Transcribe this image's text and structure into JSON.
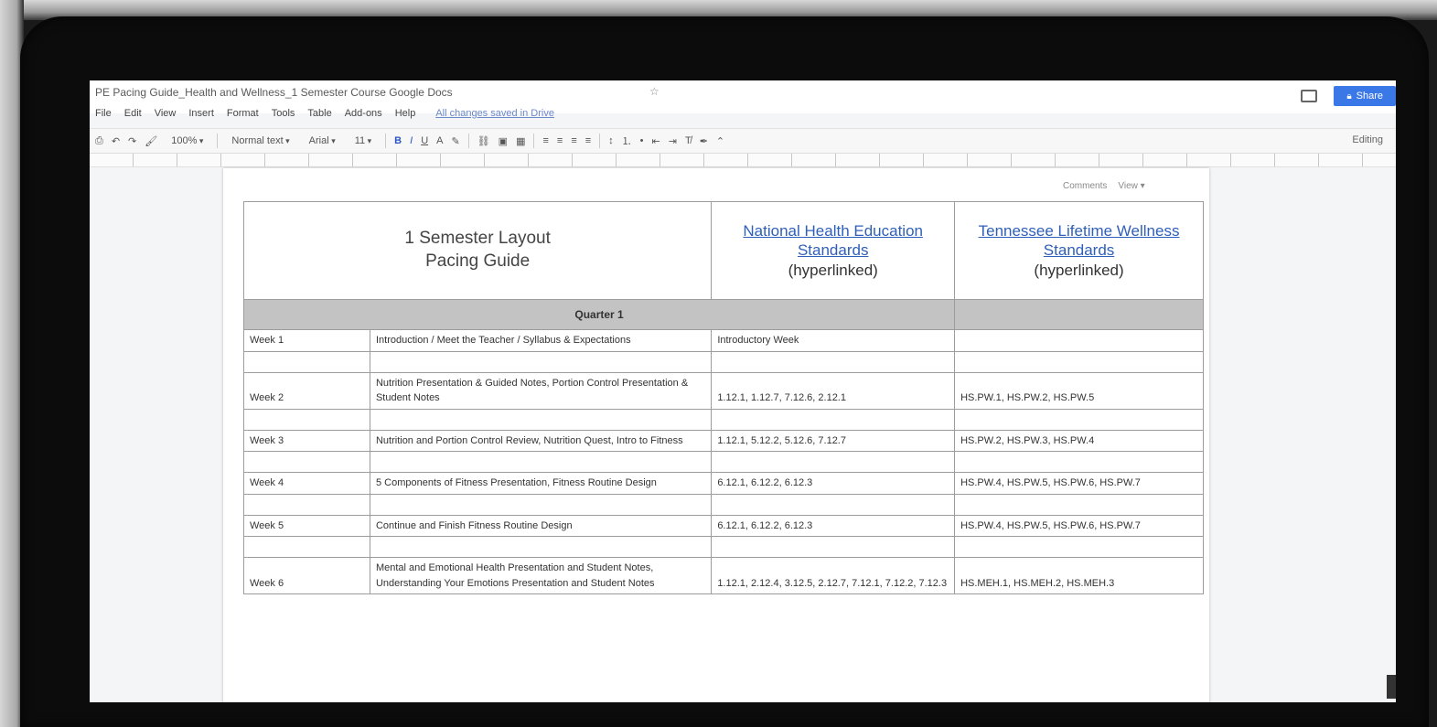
{
  "document": {
    "title": "PE Pacing Guide_Health and Wellness_1 Semester Course Google Docs",
    "star_icon": "star-icon",
    "share_label": "Share",
    "editing_label": "Editing"
  },
  "menu": {
    "items": [
      "File",
      "Edit",
      "View",
      "Insert",
      "Format",
      "Tools",
      "Table",
      "Add-ons",
      "Help"
    ],
    "last_edit": "All changes saved in Drive"
  },
  "toolbar": {
    "zoom": "100%",
    "style": "Normal text",
    "font": "Arial",
    "size": "11",
    "bold": "B",
    "italic": "I",
    "underline": "U",
    "text_color": "A"
  },
  "page_tools": {
    "left": "Comments",
    "right": "View"
  },
  "table": {
    "header": {
      "title_line1": "1 Semester Layout",
      "title_line2": "Pacing Guide",
      "national_link": "National Health Education Standards",
      "national_note": "(hyperlinked)",
      "tn_link": "Tennessee Lifetime Wellness Standards",
      "tn_note": "(hyperlinked)"
    },
    "section_title": "Quarter 1",
    "rows": [
      {
        "week": "Week 1",
        "topic": "Introduction / Meet the Teacher / Syllabus & Expectations",
        "national": "Introductory Week",
        "tn": ""
      },
      {
        "week": "Week 2",
        "topic": "Nutrition Presentation & Guided Notes, Portion Control Presentation & Student Notes",
        "national": "1.12.1, 1.12.7, 7.12.6, 2.12.1",
        "tn": "HS.PW.1, HS.PW.2, HS.PW.5"
      },
      {
        "week": "Week 3",
        "topic": "Nutrition and Portion Control Review, Nutrition Quest, Intro to Fitness",
        "national": "1.12.1, 5.12.2, 5.12.6, 7.12.7",
        "tn": "HS.PW.2, HS.PW.3, HS.PW.4"
      },
      {
        "week": "Week 4",
        "topic": "5 Components of Fitness Presentation, Fitness Routine Design",
        "national": "6.12.1, 6.12.2, 6.12.3",
        "tn": "HS.PW.4, HS.PW.5, HS.PW.6, HS.PW.7"
      },
      {
        "week": "Week 5",
        "topic": "Continue and Finish Fitness Routine Design",
        "national": "6.12.1, 6.12.2, 6.12.3",
        "tn": "HS.PW.4, HS.PW.5, HS.PW.6, HS.PW.7"
      },
      {
        "week": "Week 6",
        "topic": "Mental and Emotional Health Presentation and Student Notes, Understanding Your Emotions Presentation and Student Notes",
        "national": "1.12.1, 2.12.4, 3.12.5, 2.12.7, 7.12.1, 7.12.2, 7.12.3",
        "tn": "HS.MEH.1, HS.MEH.2, HS.MEH.3"
      }
    ]
  }
}
